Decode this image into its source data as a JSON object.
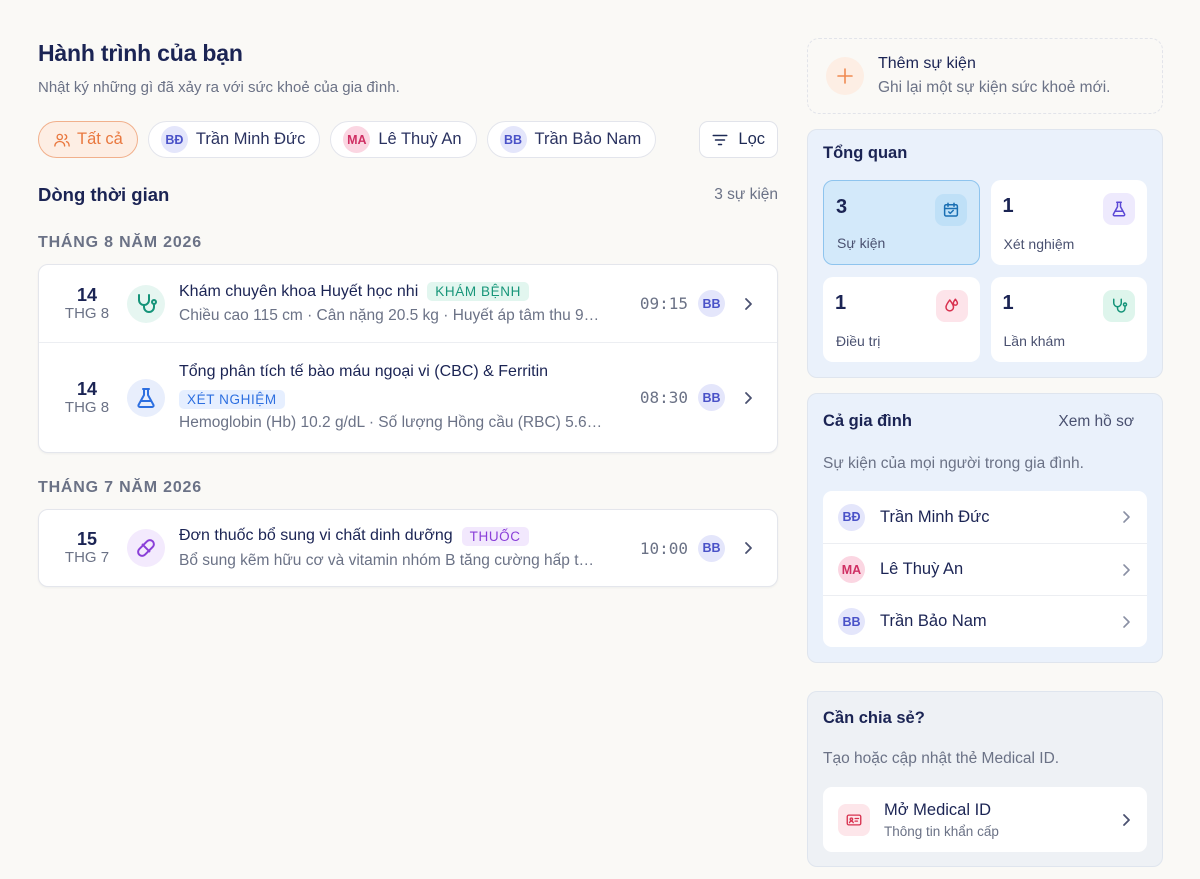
{
  "header": {
    "title": "Hành trình của bạn",
    "subtitle": "Nhật ký những gì đã xảy ra với sức khoẻ của gia đình."
  },
  "filters": {
    "all_label": "Tất cả",
    "members": [
      {
        "initials": "BĐ",
        "name": "Trần Minh Đức"
      },
      {
        "initials": "MA",
        "name": "Lê Thuỳ An"
      },
      {
        "initials": "BB",
        "name": "Trần Bảo Nam"
      }
    ],
    "filter_label": "Lọc"
  },
  "timeline": {
    "title": "Dòng thời gian",
    "count": "3 sự kiện",
    "groups": [
      {
        "month": "THÁNG 8 NĂM 2026",
        "events": [
          {
            "day": "14",
            "month": "THG 8",
            "title": "Khám chuyên khoa Huyết học nhi",
            "tag": "KHÁM BỆNH",
            "desc": "Chiều cao 115 cm · Cân nặng 20.5 kg · Huyết áp tâm thu 9…",
            "time": "09:15",
            "avatar": "BB",
            "icon": "stethoscope-icon"
          },
          {
            "day": "14",
            "month": "THG 8",
            "title": "Tổng phân tích tế bào máu ngoại vi (CBC) & Ferritin",
            "tag": "XÉT NGHIỆM",
            "desc": "Hemoglobin (Hb) 10.2 g/dL · Số lượng Hồng cầu (RBC) 5.6…",
            "time": "08:30",
            "avatar": "BB",
            "icon": "flask-icon"
          }
        ]
      },
      {
        "month": "THÁNG 7 NĂM 2026",
        "events": [
          {
            "day": "15",
            "month": "THG 7",
            "title": "Đơn thuốc bổ sung vi chất dinh dưỡng",
            "tag": "THUỐC",
            "desc": "Bổ sung kẽm hữu cơ và vitamin nhóm B tăng cường hấp t…",
            "time": "10:00",
            "avatar": "BB",
            "icon": "pill-icon"
          }
        ]
      }
    ]
  },
  "add_event": {
    "title": "Thêm sự kiện",
    "subtitle": "Ghi lại một sự kiện sức khoẻ mới."
  },
  "overview": {
    "title": "Tổng quan",
    "stats": [
      {
        "value": "3",
        "label": "Sự kiện",
        "icon": "calendar-check-icon"
      },
      {
        "value": "1",
        "label": "Xét nghiệm",
        "icon": "flask-icon"
      },
      {
        "value": "1",
        "label": "Điều trị",
        "icon": "drops-icon"
      },
      {
        "value": "1",
        "label": "Lần khám",
        "icon": "stethoscope-icon"
      }
    ]
  },
  "family": {
    "title": "Cả gia đình",
    "link": "Xem hồ sơ",
    "subtitle": "Sự kiện của mọi người trong gia đình.",
    "members": [
      {
        "initials": "BĐ",
        "name": "Trần Minh Đức"
      },
      {
        "initials": "MA",
        "name": "Lê Thuỳ An"
      },
      {
        "initials": "BB",
        "name": "Trần Bảo Nam"
      }
    ]
  },
  "share": {
    "title": "Cần chia sẻ?",
    "subtitle": "Tạo hoặc cập nhật thẻ Medical ID.",
    "button_title": "Mở Medical ID",
    "button_note": "Thông tin khẩn cấp"
  },
  "colors": {
    "accent": "#e9783f",
    "navy": "#1b2454",
    "muted": "#6b7286",
    "panel": "#eaf1fb"
  }
}
